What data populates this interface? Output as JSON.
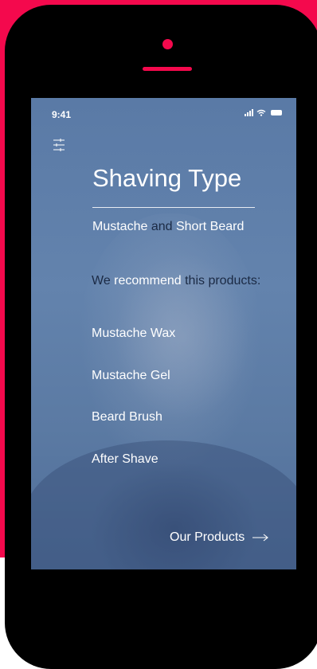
{
  "colors": {
    "accent": "#f4094d",
    "phone": "#000000",
    "screen_tint": "#5f7fa9",
    "dark_text": "#1b2a44",
    "light_text": "#ffffff"
  },
  "status_bar": {
    "time": "9:41",
    "icons": [
      "signal-icon",
      "wifi-icon",
      "battery-icon"
    ]
  },
  "menu": {
    "icon": "sliders-icon"
  },
  "header": {
    "title": "Shaving Type"
  },
  "shaving_type": {
    "part1": "Mustache",
    "connector": "and",
    "part2": "Short Beard"
  },
  "recommendation": {
    "we": "We",
    "recommend": "recommend",
    "rest": "this products:"
  },
  "products": [
    {
      "label": "Mustache Wax"
    },
    {
      "label": "Mustache Gel"
    },
    {
      "label": "Beard Brush"
    },
    {
      "label": "After Shave"
    }
  ],
  "footer": {
    "link_label": "Our Products",
    "link_icon": "arrow-right-icon"
  }
}
